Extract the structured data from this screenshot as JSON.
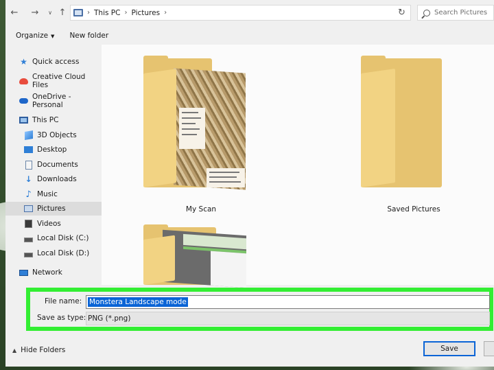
{
  "address_bar": {
    "crumbs": [
      "This PC",
      "Pictures"
    ],
    "search_placeholder": "Search Pictures"
  },
  "toolbar": {
    "organize_label": "Organize",
    "new_folder_label": "New folder"
  },
  "sidebar": {
    "items": [
      {
        "label": "Quick access",
        "icon": "star-icon"
      },
      {
        "label": "Creative Cloud Files",
        "icon": "creative-cloud-icon"
      },
      {
        "label": "OneDrive - Personal",
        "icon": "onedrive-icon"
      },
      {
        "label": "This PC",
        "icon": "computer-icon"
      },
      {
        "label": "3D Objects",
        "icon": "3d-objects-icon"
      },
      {
        "label": "Desktop",
        "icon": "desktop-icon"
      },
      {
        "label": "Documents",
        "icon": "documents-icon"
      },
      {
        "label": "Downloads",
        "icon": "downloads-icon"
      },
      {
        "label": "Music",
        "icon": "music-icon"
      },
      {
        "label": "Pictures",
        "icon": "pictures-icon",
        "selected": true
      },
      {
        "label": "Videos",
        "icon": "videos-icon"
      },
      {
        "label": "Local Disk (C:)",
        "icon": "disk-icon"
      },
      {
        "label": "Local Disk (D:)",
        "icon": "disk-icon"
      },
      {
        "label": "Network",
        "icon": "network-icon"
      }
    ]
  },
  "folders": [
    {
      "name": "My Scan"
    },
    {
      "name": "Saved Pictures"
    },
    {
      "name": ""
    }
  ],
  "save_form": {
    "file_name_label": "File name:",
    "file_name_value": "Monstera Landscape mode",
    "save_type_label": "Save as type:",
    "save_type_value": "PNG (*.png)"
  },
  "footer": {
    "hide_folders_label": "Hide Folders",
    "save_label": "Save"
  },
  "colors": {
    "highlight_border": "#33ee33",
    "selection": "#0a64d6",
    "folder": "#f2d383"
  }
}
